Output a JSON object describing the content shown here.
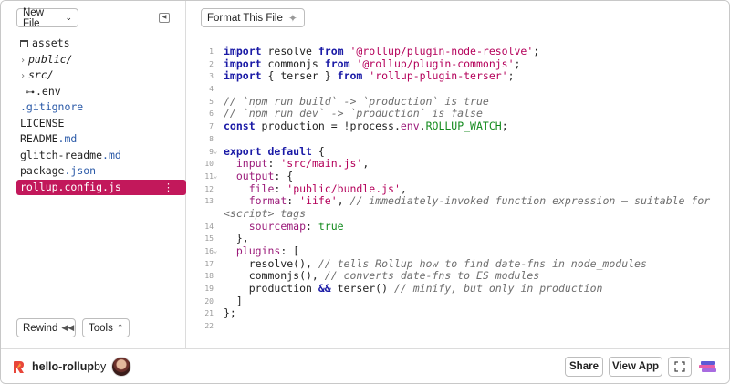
{
  "sidebar": {
    "new_file_label": "New File",
    "collapse_icon": "collapse-sidebar-icon",
    "files": [
      {
        "name": "assets",
        "ext": "",
        "kind": "assets"
      },
      {
        "name": "public/",
        "ext": "",
        "kind": "folder"
      },
      {
        "name": "src/",
        "ext": "",
        "kind": "folder"
      },
      {
        "name": ".env",
        "ext": "",
        "kind": "env"
      },
      {
        "name": "",
        "ext": ".gitignore",
        "kind": "dotfile"
      },
      {
        "name": "LICENSE",
        "ext": "",
        "kind": "file"
      },
      {
        "name": "README",
        "ext": ".md",
        "kind": "file"
      },
      {
        "name": "glitch-readme",
        "ext": ".md",
        "kind": "file"
      },
      {
        "name": "package",
        "ext": ".json",
        "kind": "file"
      },
      {
        "name": "rollup.config.js",
        "ext": "",
        "kind": "active"
      }
    ],
    "rewind_label": "Rewind",
    "tools_label": "Tools"
  },
  "editor": {
    "format_label": "Format This File",
    "line_numbers": [
      "1",
      "2",
      "3",
      "4",
      "5",
      "6",
      "7",
      "8",
      "9",
      "10",
      "11",
      "12",
      "13",
      "",
      "14",
      "15",
      "16",
      "17",
      "18",
      "19",
      "20",
      "21",
      "22"
    ]
  },
  "footer": {
    "project_name": "hello-rollup",
    "by_label": "by",
    "share_label": "Share",
    "view_app_label": "View App",
    "accent_color": "#c2185b"
  }
}
